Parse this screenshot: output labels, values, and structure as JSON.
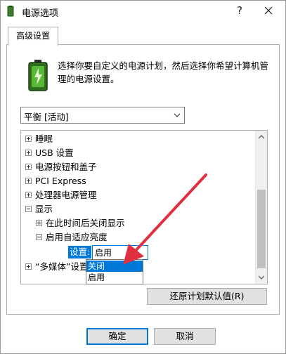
{
  "window": {
    "title": "电源选项",
    "help_glyph": "?"
  },
  "tabs": [
    {
      "label": "高级设置"
    }
  ],
  "description": "选择你要自定义的电源计划，然后选择你希望计算机管理的电源设置。",
  "plan_select": {
    "value": "平衡 [活动]"
  },
  "tree": {
    "items": [
      {
        "label": "睡眠",
        "level": 0,
        "expander": "plus"
      },
      {
        "label": "USB 设置",
        "level": 0,
        "expander": "plus"
      },
      {
        "label": "电源按钮和盖子",
        "level": 0,
        "expander": "plus"
      },
      {
        "label": "PCI Express",
        "level": 0,
        "expander": "plus"
      },
      {
        "label": "处理器电源管理",
        "level": 0,
        "expander": "plus"
      },
      {
        "label": "显示",
        "level": 0,
        "expander": "minus"
      },
      {
        "label": "在此时间后关闭显示",
        "level": 1,
        "expander": "plus"
      },
      {
        "label": "启用自适应亮度",
        "level": 1,
        "expander": "minus"
      },
      {
        "label": "“多媒体”设置",
        "level": 0,
        "expander": "plus"
      }
    ],
    "setting_label": "设置:",
    "setting_value": "启用"
  },
  "dropdown": {
    "options": [
      {
        "label": "关闭",
        "selected": true
      },
      {
        "label": "启用",
        "selected": false
      }
    ]
  },
  "buttons": {
    "restore_defaults": "还原计划默认值(R)",
    "ok": "确定",
    "cancel": "取消"
  },
  "colors": {
    "selection": "#0078d7",
    "annotation_arrow": "#e03040"
  }
}
